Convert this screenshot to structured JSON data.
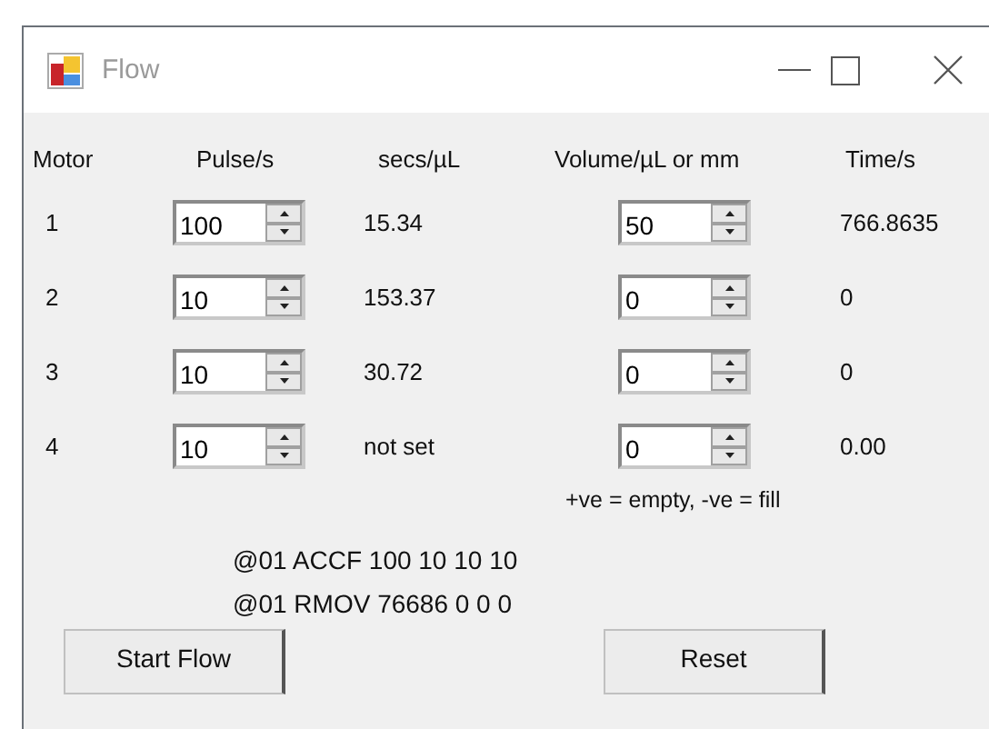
{
  "window": {
    "title": "Flow"
  },
  "columns": [
    "Motor",
    "Pulse/s",
    "secs/µL",
    "Volume/µL or mm",
    "Time/s"
  ],
  "motors": [
    {
      "motor": "1",
      "pulse": "100",
      "secs_per_ul": "15.34",
      "volume": "50",
      "time": "766.8635"
    },
    {
      "motor": "2",
      "pulse": "10",
      "secs_per_ul": "153.37",
      "volume": "0",
      "time": "0"
    },
    {
      "motor": "3",
      "pulse": "10",
      "secs_per_ul": "30.72",
      "volume": "0",
      "time": "0"
    },
    {
      "motor": "4",
      "pulse": "10",
      "secs_per_ul": "not set",
      "volume": "0",
      "time": "0.00"
    }
  ],
  "volume_note": "+ve = empty, -ve = fill",
  "commands": [
    "@01 ACCF 100 10 10 10",
    "@01 RMOV 76686 0 0 0"
  ],
  "buttons": [
    "Start Flow",
    "Reset"
  ]
}
